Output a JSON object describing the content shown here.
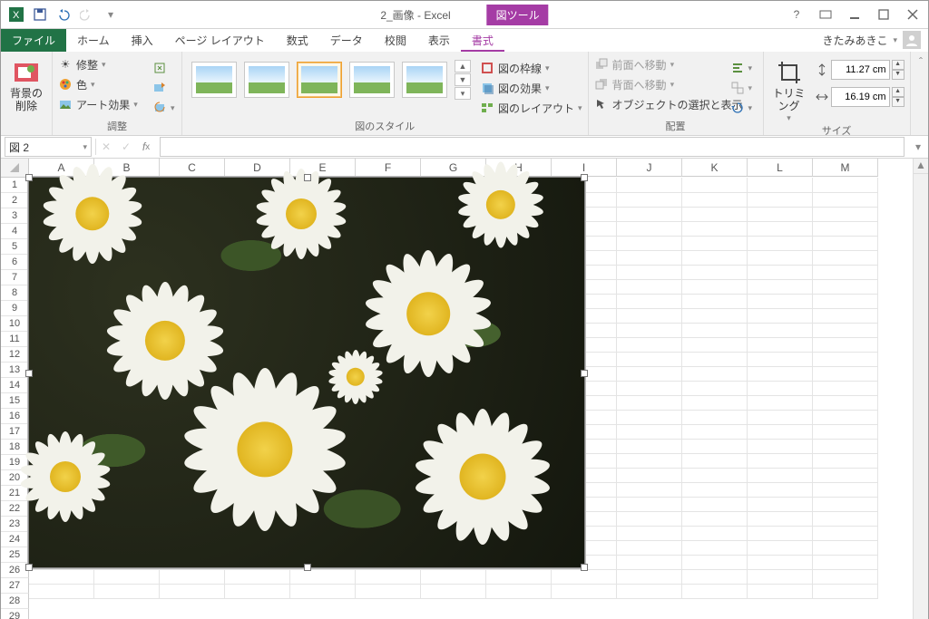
{
  "title": {
    "doc": "2_画像 - Excel",
    "contextTab": "図ツール"
  },
  "user": {
    "name": "きたみあきこ"
  },
  "tabs": {
    "file": "ファイル",
    "items": [
      "ホーム",
      "挿入",
      "ページ レイアウト",
      "数式",
      "データ",
      "校閲",
      "表示",
      "書式"
    ],
    "activeIndex": 7
  },
  "ribbon": {
    "removeBg": "背景の\n削除",
    "adjust": {
      "corrections": "修整",
      "color": "色",
      "artistic": "アート効果",
      "label": "調整"
    },
    "styles": {
      "label": "図のスタイル",
      "border": "図の枠線",
      "effects": "図の効果",
      "layout": "図のレイアウト"
    },
    "arrange": {
      "bringFwd": "前面へ移動",
      "sendBack": "背面へ移動",
      "selection": "オブジェクトの選択と表示",
      "label": "配置"
    },
    "crop": "トリミング",
    "size": {
      "label": "サイズ",
      "height": "11.27 cm",
      "width": "16.19 cm"
    }
  },
  "namebox": "図 2",
  "columns": [
    "A",
    "B",
    "C",
    "D",
    "E",
    "F",
    "G",
    "H",
    "I",
    "J",
    "K",
    "L",
    "M"
  ],
  "rowCount": 29
}
